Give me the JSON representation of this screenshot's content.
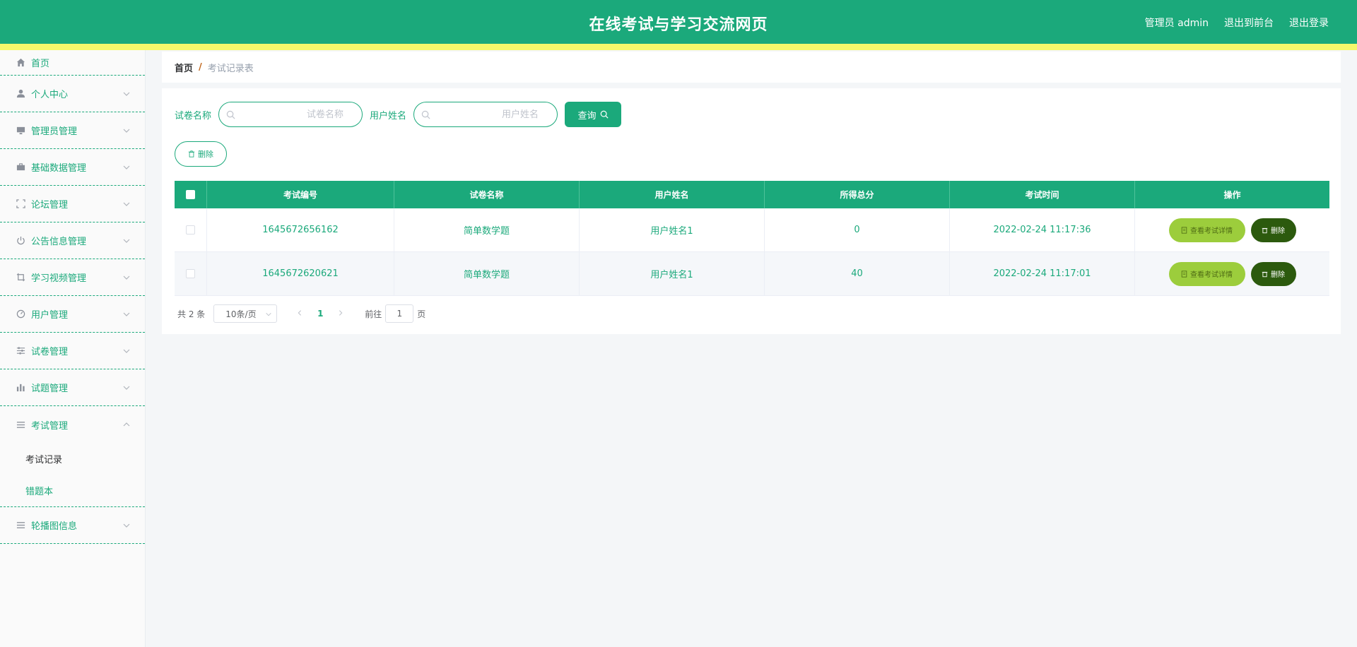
{
  "header": {
    "title": "在线考试与学习交流网页",
    "user": "管理员 admin",
    "to_front": "退出到前台",
    "logout": "退出登录",
    "colors": {
      "primary": "#1ba97b",
      "accent_strip": "#f5f86b"
    }
  },
  "sidebar": {
    "items": [
      {
        "label": "首页",
        "icon": "home-icon"
      },
      {
        "label": "个人中心",
        "icon": "user-icon"
      },
      {
        "label": "管理员管理",
        "icon": "monitor-icon"
      },
      {
        "label": "基础数据管理",
        "icon": "briefcase-icon"
      },
      {
        "label": "论坛管理",
        "icon": "fullscreen-icon"
      },
      {
        "label": "公告信息管理",
        "icon": "power-icon"
      },
      {
        "label": "学习视频管理",
        "icon": "crop-icon"
      },
      {
        "label": "用户管理",
        "icon": "gauge-icon"
      },
      {
        "label": "试卷管理",
        "icon": "sliders-icon"
      },
      {
        "label": "试题管理",
        "icon": "bar-chart-icon"
      },
      {
        "label": "考试管理",
        "icon": "menu-icon"
      },
      {
        "label": "轮播图信息",
        "icon": "menu-icon"
      }
    ],
    "exam_sub": [
      {
        "label": "考试记录"
      },
      {
        "label": "错题本"
      }
    ]
  },
  "breadcrumb": {
    "home": "首页",
    "separator": "/",
    "current": "考试记录表"
  },
  "search": {
    "paper_label": "试卷名称",
    "paper_placeholder": "试卷名称",
    "user_label": "用户姓名",
    "user_placeholder": "用户姓名",
    "query_button": "查询"
  },
  "toolbar": {
    "delete_label": "删除"
  },
  "table": {
    "columns": [
      "考试编号",
      "试卷名称",
      "用户姓名",
      "所得总分",
      "考试时间",
      "操作"
    ],
    "rows": [
      {
        "exam_no": "1645672656162",
        "paper": "简单数学题",
        "user": "用户姓名1",
        "score": "0",
        "time": "2022-02-24 11:17:36"
      },
      {
        "exam_no": "1645672620621",
        "paper": "简单数学题",
        "user": "用户姓名1",
        "score": "40",
        "time": "2022-02-24 11:17:01"
      }
    ],
    "detail_button": "查看考试详情",
    "delete_button": "删除"
  },
  "pagination": {
    "total": "共 2 条",
    "page_size": "10条/页",
    "current_page": "1",
    "goto_prefix": "前往",
    "goto_value": "1",
    "goto_suffix": "页"
  }
}
